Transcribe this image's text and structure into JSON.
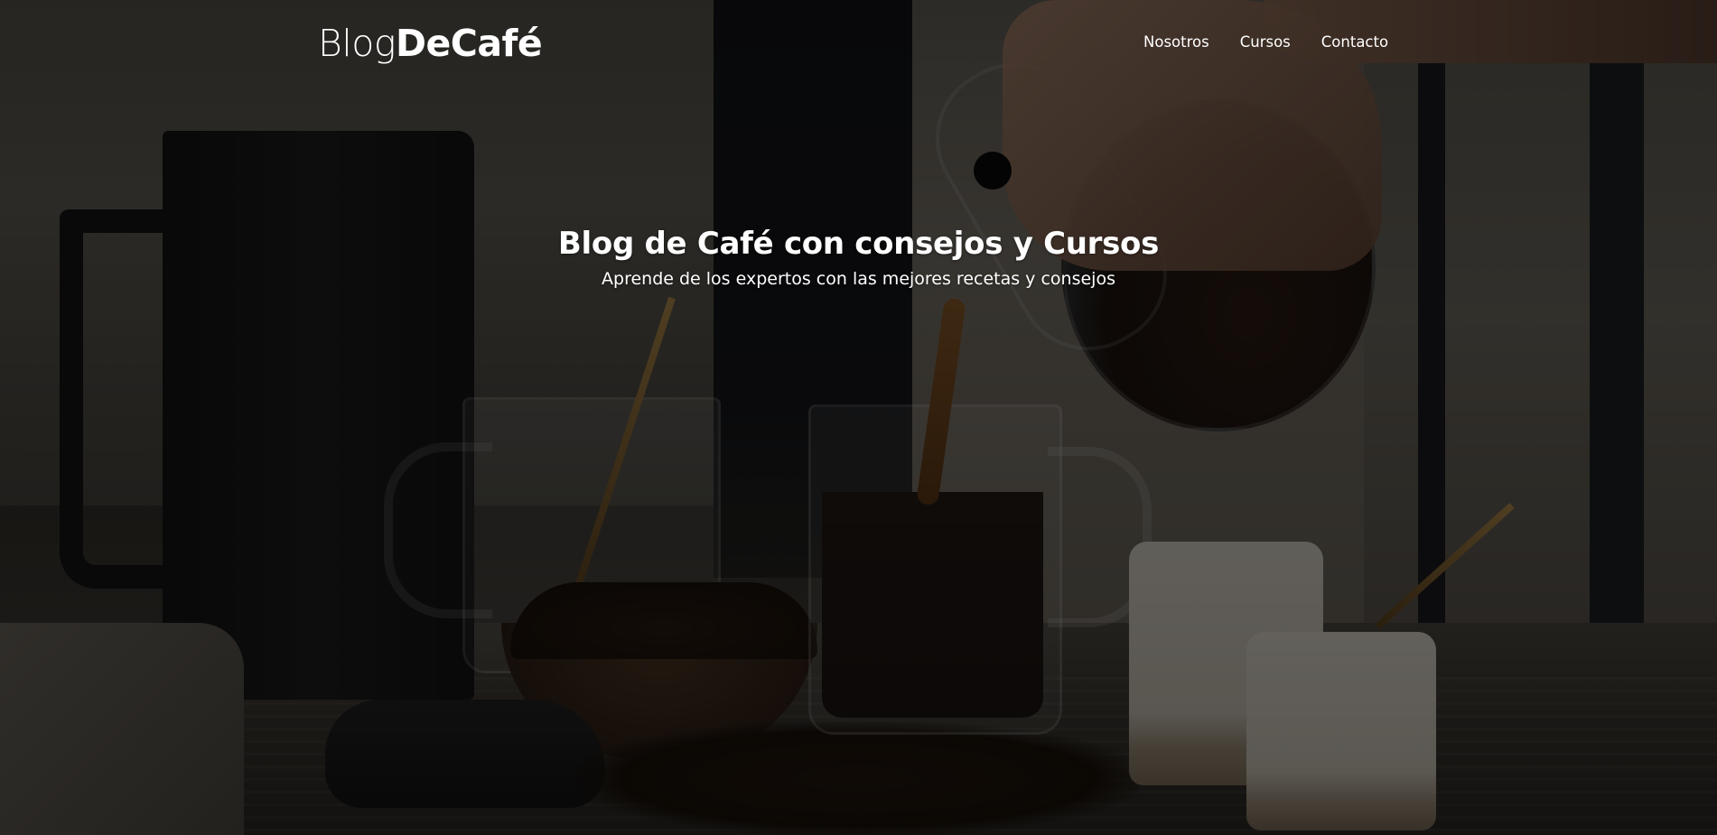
{
  "header": {
    "logo_light": "Blog",
    "logo_bold": "DeCafé"
  },
  "nav": {
    "items": [
      {
        "label": "Nosotros"
      },
      {
        "label": "Cursos"
      },
      {
        "label": "Contacto"
      }
    ]
  },
  "hero": {
    "title": "Blog de Café con consejos y Cursos",
    "subtitle": "Aprende de los expertos con las mejores recetas y consejos",
    "background_image": "coffee-pour-photo",
    "overlay_color": "#000000"
  },
  "colors": {
    "text": "#ffffff"
  }
}
